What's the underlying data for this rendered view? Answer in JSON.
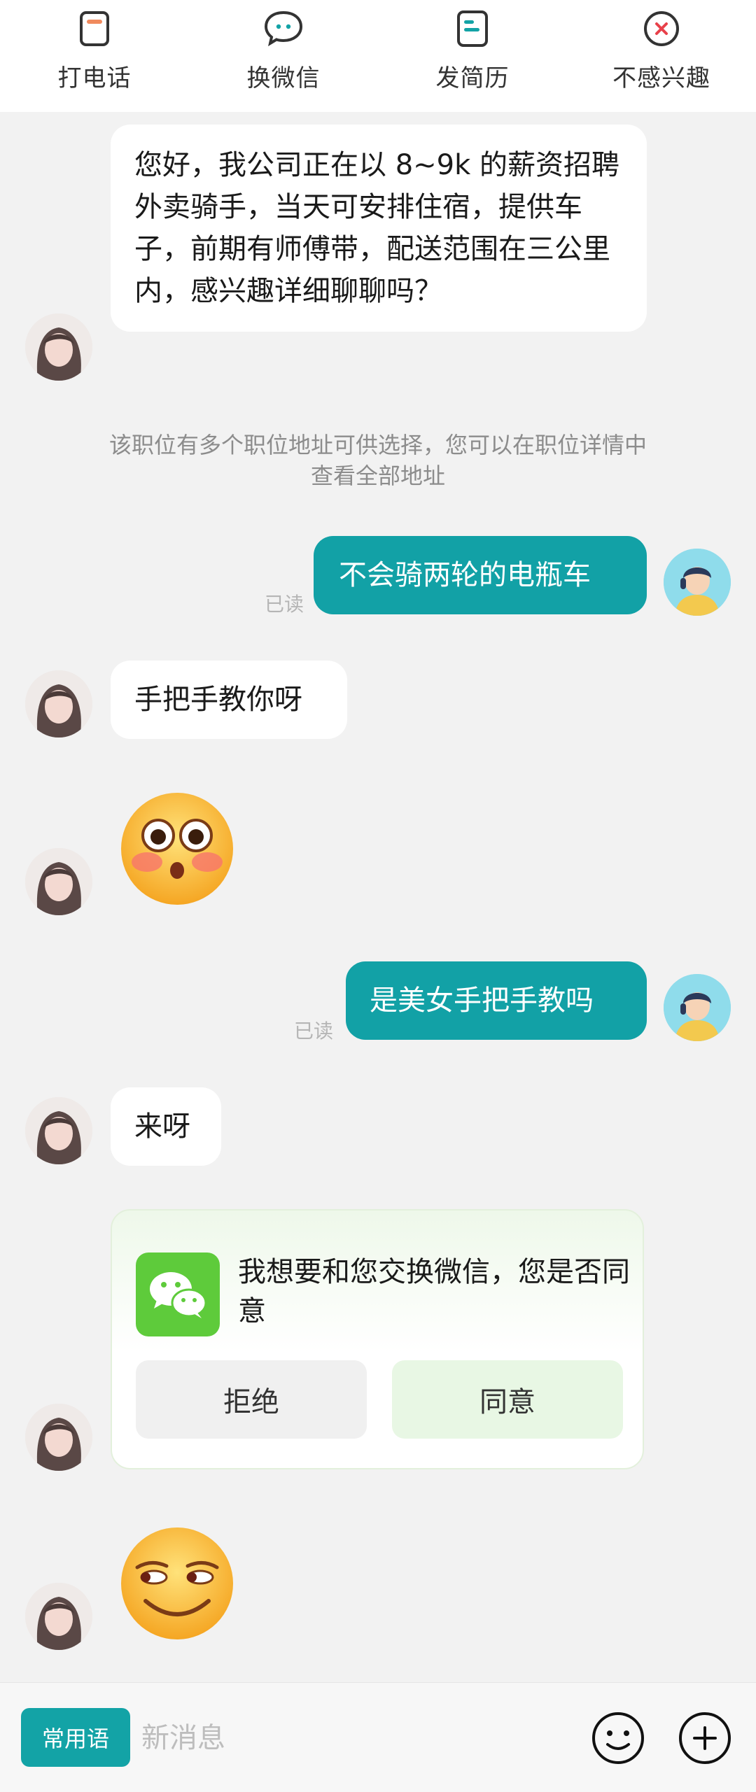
{
  "toolbar": {
    "items": [
      {
        "label": "打电话",
        "icon": "phone-icon"
      },
      {
        "label": "换微信",
        "icon": "wechat-icon"
      },
      {
        "label": "发简历",
        "icon": "resume-icon"
      },
      {
        "label": "不感兴趣",
        "icon": "not-interested-icon"
      }
    ],
    "accent_color": "#f08a5d",
    "teal_color": "#12a1a6"
  },
  "messages": {
    "m1": "您好，我公司正在以 8~9k 的薪资招聘外卖骑手，当天可安排住宿，提供车子，前期有师傅带，配送范围在三公里内，感兴趣详细聊聊吗？",
    "notice": "该职位有多个职位地址可供选择，您可以在职位详情中查看全部地址",
    "m2": "不会骑两轮的电瓶车",
    "m2_status": "已读",
    "m3": "手把手教你呀",
    "m4_emoji": "flushed-face-emoji",
    "m5": "是美女手把手教吗",
    "m5_status": "已读",
    "m6": "来呀",
    "m8_emoji": "smirk-face-emoji"
  },
  "wechat_card": {
    "text": "我想要和您交换微信，您是否同意",
    "reject_label": "拒绝",
    "agree_label": "同意",
    "logo_color": "#5ecb3b"
  },
  "input_bar": {
    "phrase_button": "常用语",
    "placeholder": "新消息",
    "emoji_icon": "smiley-icon",
    "plus_icon": "plus-icon"
  }
}
